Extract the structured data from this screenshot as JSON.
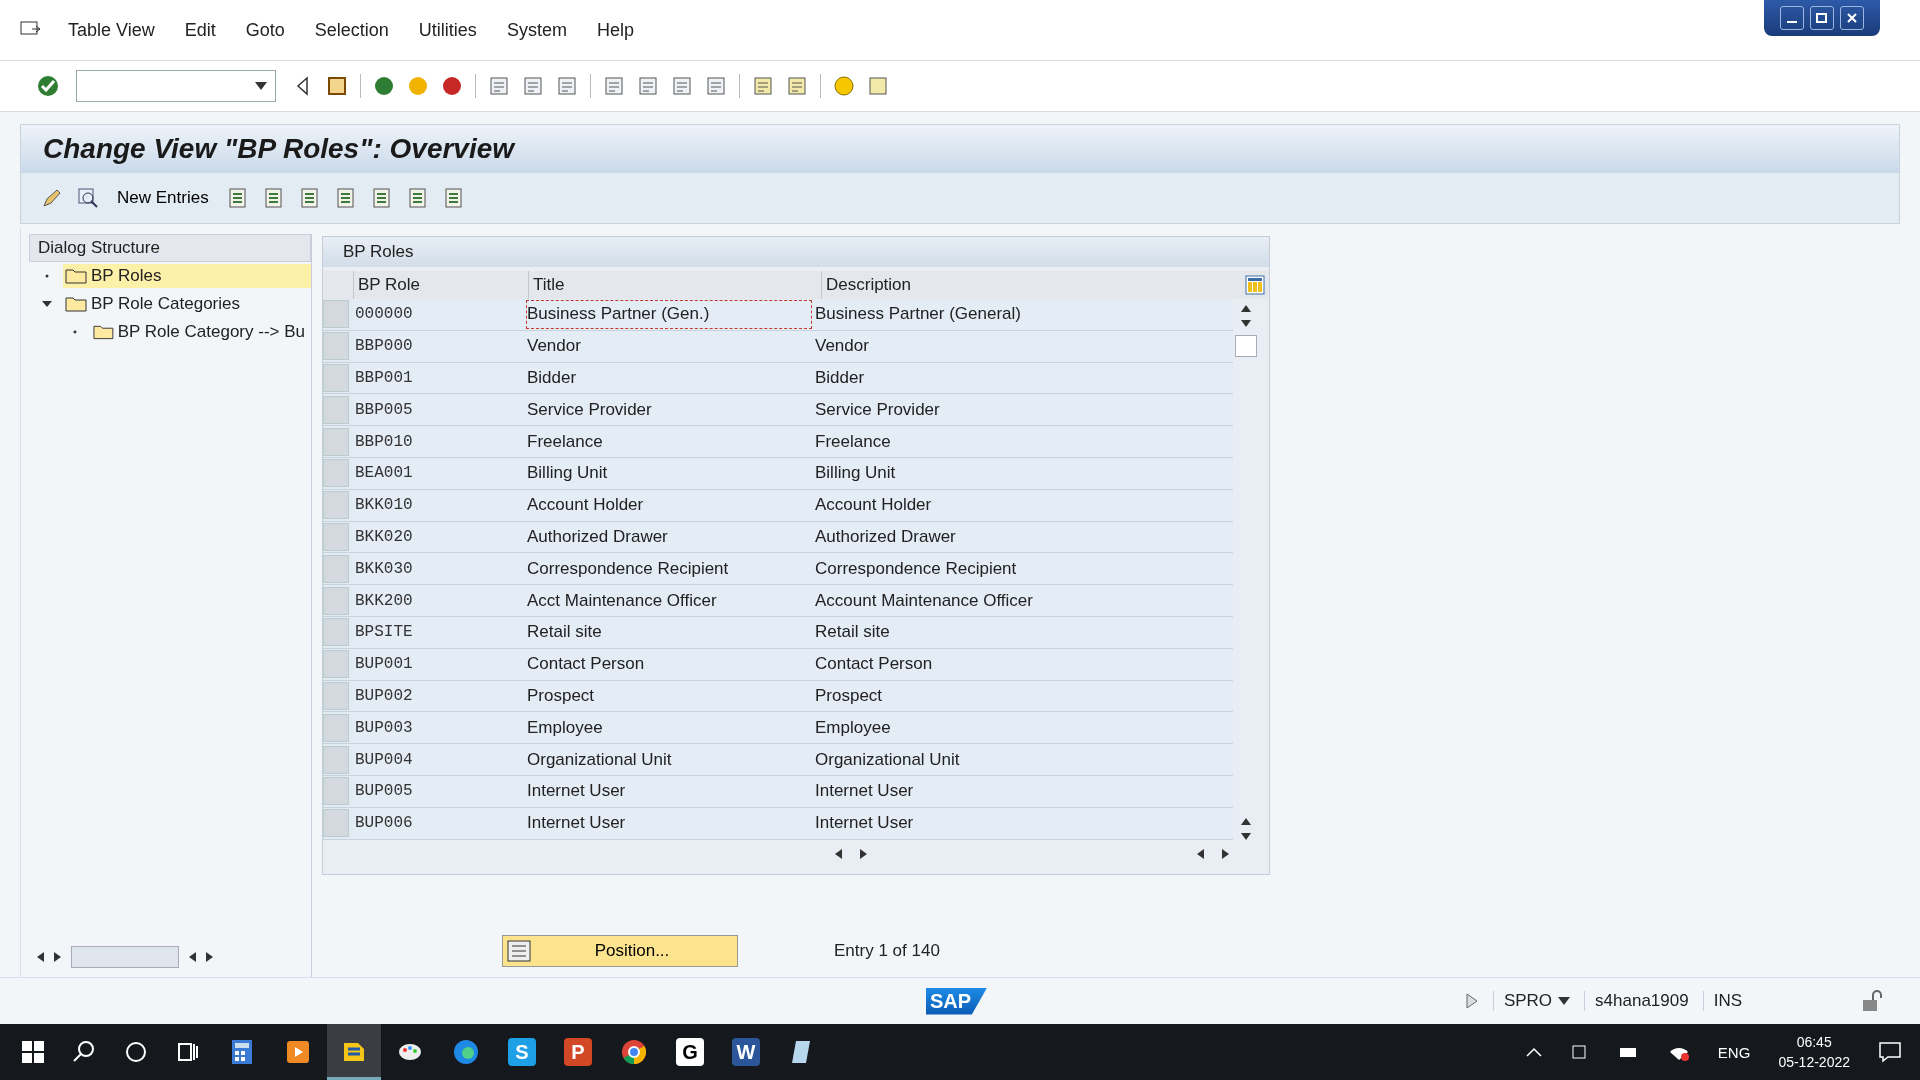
{
  "menu": [
    "Table View",
    "Edit",
    "Goto",
    "Selection",
    "Utilities",
    "System",
    "Help"
  ],
  "title": "Change View \"BP Roles\": Overview",
  "app_toolbar": {
    "new_entries": "New Entries"
  },
  "dialog_structure": {
    "heading": "Dialog Structure",
    "items": [
      {
        "label": "BP Roles",
        "selected": true
      },
      {
        "label": "BP Role Categories",
        "selected": false,
        "expanded": true,
        "children": [
          {
            "label": "BP Role Category --> Bu",
            "selected": false
          }
        ]
      }
    ]
  },
  "table": {
    "title": "BP Roles",
    "columns": [
      "BP Role",
      "Title",
      "Description"
    ],
    "rows": [
      {
        "role": "000000",
        "title": "Business Partner (Gen.)",
        "description": "Business Partner (General)",
        "focused": true
      },
      {
        "role": "BBP000",
        "title": "Vendor",
        "description": "Vendor",
        "focused": false
      },
      {
        "role": "BBP001",
        "title": "Bidder",
        "description": "Bidder",
        "focused": false
      },
      {
        "role": "BBP005",
        "title": "Service Provider",
        "description": "Service Provider",
        "focused": false
      },
      {
        "role": "BBP010",
        "title": "Freelance",
        "description": "Freelance",
        "focused": false
      },
      {
        "role": "BEA001",
        "title": "Billing Unit",
        "description": "Billing Unit",
        "focused": false
      },
      {
        "role": "BKK010",
        "title": "Account Holder",
        "description": "Account Holder",
        "focused": false
      },
      {
        "role": "BKK020",
        "title": "Authorized Drawer",
        "description": "Authorized Drawer",
        "focused": false
      },
      {
        "role": "BKK030",
        "title": "Correspondence Recipient",
        "description": "Correspondence Recipient",
        "focused": false
      },
      {
        "role": "BKK200",
        "title": "Acct Maintenance Officer",
        "description": "Account Maintenance Officer",
        "focused": false
      },
      {
        "role": "BPSITE",
        "title": "Retail site",
        "description": "Retail site",
        "focused": false
      },
      {
        "role": "BUP001",
        "title": "Contact Person",
        "description": "Contact Person",
        "focused": false
      },
      {
        "role": "BUP002",
        "title": "Prospect",
        "description": "Prospect",
        "focused": false
      },
      {
        "role": "BUP003",
        "title": "Employee",
        "description": "Employee",
        "focused": false
      },
      {
        "role": "BUP004",
        "title": "Organizational Unit",
        "description": "Organizational Unit",
        "focused": false
      },
      {
        "role": "BUP005",
        "title": "Internet User",
        "description": "Internet User",
        "focused": false
      },
      {
        "role": "BUP006",
        "title": "Internet User",
        "description": "Internet User",
        "focused": false
      }
    ]
  },
  "position_button": "Position...",
  "entry_info": "Entry 1 of 140",
  "status_bar": {
    "logo": "SAP",
    "transaction": "SPRO",
    "system": "s4hana1909",
    "mode": "INS"
  },
  "taskbar": {
    "apps": [
      {
        "kind": "folder",
        "selected": false
      },
      {
        "kind": "media",
        "selected": false
      },
      {
        "kind": "sap",
        "selected": true
      },
      {
        "kind": "paint",
        "selected": false
      },
      {
        "kind": "browser",
        "selected": false
      },
      {
        "kind": "letter",
        "selected": false,
        "letter": "S",
        "color": "#1ea0e6"
      },
      {
        "kind": "letter",
        "selected": false,
        "letter": "P",
        "color": "#d24726"
      },
      {
        "kind": "chrome",
        "selected": false
      },
      {
        "kind": "letter",
        "selected": false,
        "letter": "G",
        "color": "#ffffff"
      },
      {
        "kind": "letter",
        "selected": false,
        "letter": "W",
        "color": "#2b579a"
      },
      {
        "kind": "notes",
        "selected": false
      }
    ],
    "language": "ENG",
    "time": "06:45",
    "date": "05-12-2022"
  }
}
